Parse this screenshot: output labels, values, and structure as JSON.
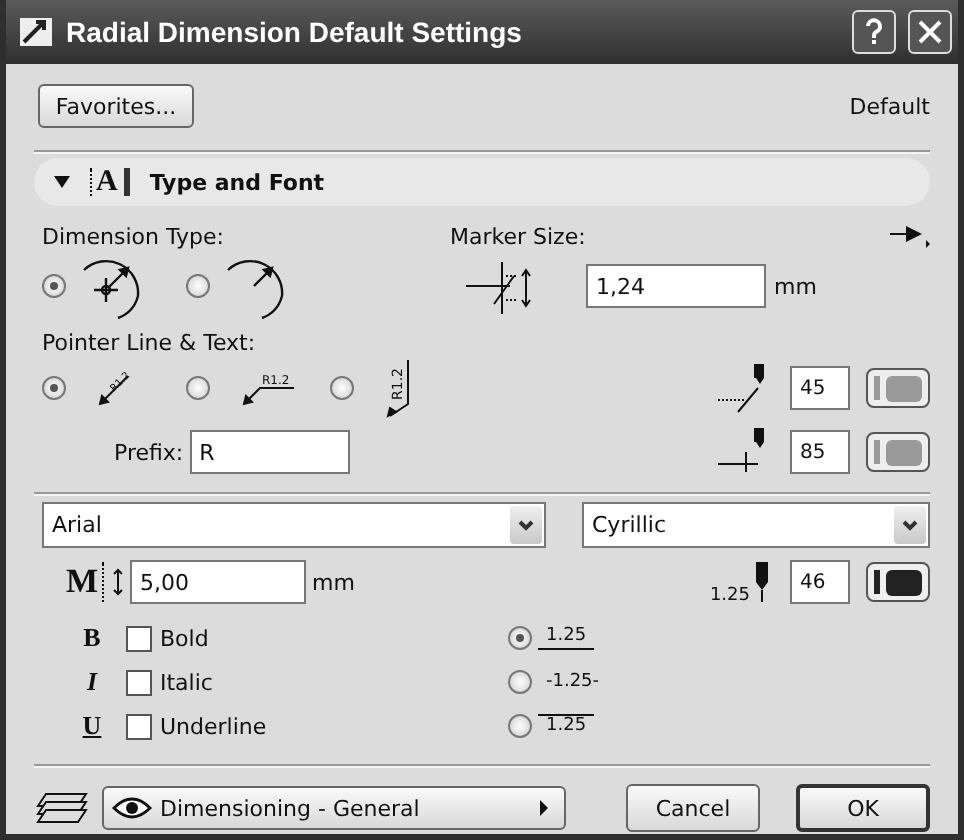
{
  "window": {
    "title": "Radial Dimension Default Settings"
  },
  "favorites_button": "Favorites...",
  "preset": "Default",
  "section": {
    "title": "Type and Font",
    "expanded": true,
    "icon_glyph": "A"
  },
  "dimension_type": {
    "label": "Dimension Type:",
    "options": [
      {
        "kind": "center",
        "selected": true
      },
      {
        "kind": "arc",
        "selected": false
      }
    ]
  },
  "marker_size": {
    "label": "Marker Size:",
    "value": "1,24",
    "unit": "mm"
  },
  "pointer": {
    "label": "Pointer Line & Text:",
    "options": [
      {
        "kind": "diagonal",
        "sample": "R1.2",
        "selected": true
      },
      {
        "kind": "horizontal",
        "sample": "R1.2",
        "selected": false
      },
      {
        "kind": "vertical",
        "sample": "R1.2",
        "selected": false
      }
    ]
  },
  "prefix": {
    "label": "Prefix:",
    "value": "R"
  },
  "pens": [
    {
      "kind": "marker",
      "value": "45",
      "on": false
    },
    {
      "kind": "line",
      "value": "85",
      "on": false
    },
    {
      "kind": "text",
      "value": "46",
      "on": true,
      "sample": "1.25"
    }
  ],
  "font": {
    "value": "Arial"
  },
  "script": {
    "value": "Cyrillic"
  },
  "text_size": {
    "glyph": "M",
    "value": "5,00",
    "unit": "mm"
  },
  "styles": [
    {
      "kind": "bold",
      "glyph": "B",
      "label": "Bold",
      "checked": false
    },
    {
      "kind": "italic",
      "glyph": "I",
      "label": "Italic",
      "checked": false
    },
    {
      "kind": "underline",
      "glyph": "U",
      "label": "Underline",
      "checked": false
    }
  ],
  "text_positions": [
    {
      "kind": "above",
      "sample": "1.25",
      "selected": true
    },
    {
      "kind": "middle",
      "sample": "-1.25-",
      "selected": false
    },
    {
      "kind": "below",
      "sample": "1.25",
      "selected": false
    }
  ],
  "layer": {
    "value": "Dimensioning - General"
  },
  "buttons": [
    {
      "label": "Cancel",
      "default": false
    },
    {
      "label": "OK",
      "default": true
    }
  ]
}
